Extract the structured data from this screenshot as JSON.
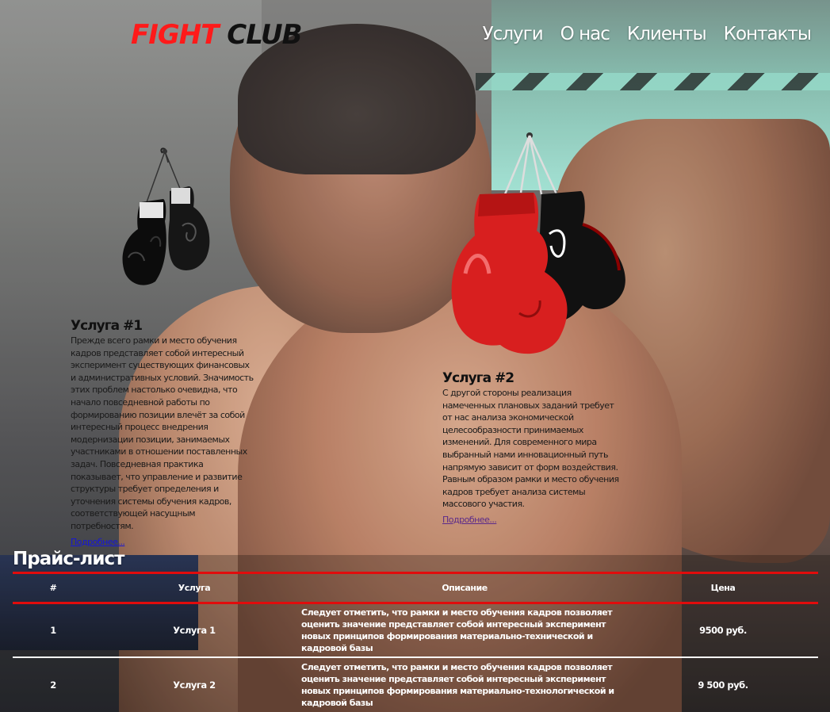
{
  "header": {
    "logo_part1": "FIGHT",
    "logo_part2": "CLUB",
    "nav": [
      "Услуги",
      "О нас",
      "Клиенты",
      "Контакты"
    ]
  },
  "services": [
    {
      "title": "Услуга #1",
      "text": "Прежде всего рамки и место обучения кадров представляет собой интересный эксперимент существующих финансовых и административных условий. Значимость этих проблем настолько очевидна, что начало повседневной работы по формированию позиции влечёт за собой интересный процесс внедрения модернизации позиции, занимаемых участниками в отношении поставленных задач. Повседневная практика показывает, что управление и развитие структуры требует определения и уточнения системы обучения кадров, соответствующей насущным потребностям.",
      "link": "Подробнее...",
      "glove": "black-boxing-gloves-icon"
    },
    {
      "title": "Услуга #2",
      "text": "С другой стороны реализация намеченных плановых заданий требует от нас анализа экономической целесообразности принимаемых изменений. Для современного мира выбранный нами инновационный путь напрямую зависит от форм воздействия. Равным образом рамки и место обучения кадров требует анализа системы массового участия.",
      "link": "Подробнее...",
      "glove": "red-boxing-gloves-icon"
    }
  ],
  "price_list": {
    "title": "Прайс-лист",
    "columns": [
      "#",
      "Услуга",
      "Описание",
      "Цена"
    ],
    "rows": [
      {
        "num": "1",
        "name": "Услуга 1",
        "description": "Следует отметить, что рамки и место обучения кадров позволяет оценить значение представляет собой интересный эксперимент новых принципов формирования материально-технической и кадровой базы",
        "price": "9500 руб."
      },
      {
        "num": "2",
        "name": "Услуга 2",
        "description": "Следует отметить, что рамки и место обучения кадров позволяет оценить значение представляет собой интересный эксперимент новых принципов формирования материально-технологической и кадровой базы",
        "price": "9 500 руб."
      }
    ]
  },
  "colors": {
    "accent_red": "#e10c0c",
    "logo_red": "#ff1a1a",
    "link_blue": "#1515d8"
  }
}
